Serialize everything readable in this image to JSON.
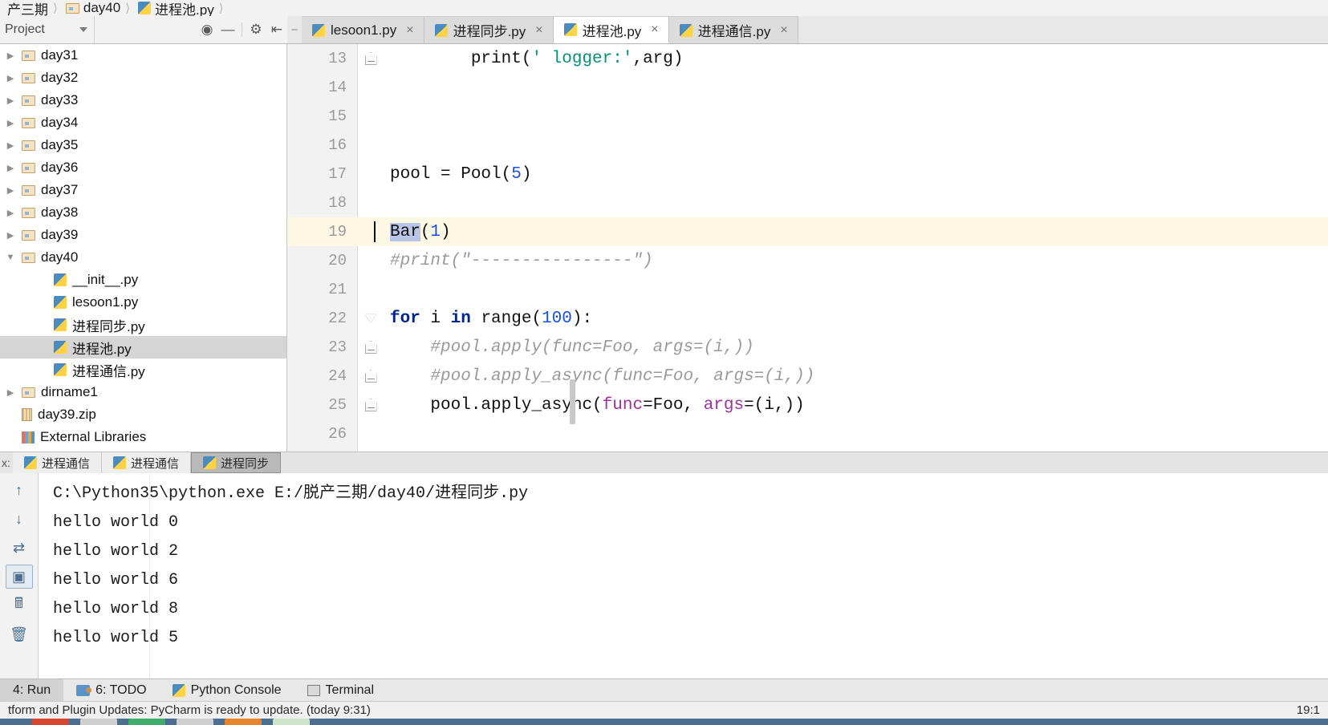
{
  "breadcrumb": {
    "items": [
      {
        "label": "产三期",
        "icon": "none"
      },
      {
        "label": "day40",
        "icon": "folder-icon"
      },
      {
        "label": "进程池.py",
        "icon": "python-file-icon"
      }
    ]
  },
  "project_toolbar": {
    "title": "Project",
    "icons": [
      "target-icon",
      "collapse-all-icon",
      "settings-gear-icon",
      "hide-panel-icon"
    ]
  },
  "editor_tabs": [
    {
      "label": "lesoon1.py",
      "active": false,
      "close": "×"
    },
    {
      "label": "进程同步.py",
      "active": false,
      "close": "×"
    },
    {
      "label": "进程池.py",
      "active": true,
      "close": "×"
    },
    {
      "label": "进程通信.py",
      "active": false,
      "close": "×"
    }
  ],
  "project_tree": [
    {
      "label": "day31",
      "type": "folder",
      "indent": 0,
      "expanded": false,
      "selected": false
    },
    {
      "label": "day32",
      "type": "folder",
      "indent": 0,
      "expanded": false,
      "selected": false
    },
    {
      "label": "day33",
      "type": "folder",
      "indent": 0,
      "expanded": false,
      "selected": false
    },
    {
      "label": "day34",
      "type": "folder",
      "indent": 0,
      "expanded": false,
      "selected": false
    },
    {
      "label": "day35",
      "type": "folder",
      "indent": 0,
      "expanded": false,
      "selected": false
    },
    {
      "label": "day36",
      "type": "folder",
      "indent": 0,
      "expanded": false,
      "selected": false
    },
    {
      "label": "day37",
      "type": "folder",
      "indent": 0,
      "expanded": false,
      "selected": false
    },
    {
      "label": "day38",
      "type": "folder",
      "indent": 0,
      "expanded": false,
      "selected": false
    },
    {
      "label": "day39",
      "type": "folder",
      "indent": 0,
      "expanded": false,
      "selected": false
    },
    {
      "label": "day40",
      "type": "folder",
      "indent": 0,
      "expanded": true,
      "selected": false
    },
    {
      "label": "__init__.py",
      "type": "python",
      "indent": 1,
      "expanded": false,
      "selected": false
    },
    {
      "label": "lesoon1.py",
      "type": "python",
      "indent": 1,
      "expanded": false,
      "selected": false
    },
    {
      "label": "进程同步.py",
      "type": "python",
      "indent": 1,
      "expanded": false,
      "selected": false
    },
    {
      "label": "进程池.py",
      "type": "python",
      "indent": 1,
      "expanded": false,
      "selected": true
    },
    {
      "label": "进程通信.py",
      "type": "python",
      "indent": 1,
      "expanded": false,
      "selected": false
    },
    {
      "label": "dirname1",
      "type": "folder",
      "indent": 0,
      "expanded": false,
      "selected": false
    },
    {
      "label": "day39.zip",
      "type": "zip",
      "indent": 0,
      "expanded": false,
      "selected": false
    },
    {
      "label": "External Libraries",
      "type": "library",
      "indent": -1,
      "expanded": false,
      "selected": false
    }
  ],
  "editor": {
    "lines": [
      {
        "num": "13",
        "highlight": false,
        "fold": "house",
        "tokens": [
          {
            "t": "        print",
            "c": "plain"
          },
          {
            "t": "(",
            "c": "plain"
          },
          {
            "t": "' logger:'",
            "c": "str"
          },
          {
            "t": ",arg)",
            "c": "plain"
          }
        ]
      },
      {
        "num": "14",
        "highlight": false,
        "fold": "none",
        "tokens": []
      },
      {
        "num": "15",
        "highlight": false,
        "fold": "none",
        "tokens": []
      },
      {
        "num": "16",
        "highlight": false,
        "fold": "none",
        "tokens": []
      },
      {
        "num": "17",
        "highlight": false,
        "fold": "none",
        "tokens": [
          {
            "t": "pool = Pool",
            "c": "plain"
          },
          {
            "t": "(",
            "c": "plain"
          },
          {
            "t": "5",
            "c": "num"
          },
          {
            "t": ")",
            "c": "plain"
          }
        ]
      },
      {
        "num": "18",
        "highlight": false,
        "fold": "none",
        "tokens": []
      },
      {
        "num": "19",
        "highlight": true,
        "fold": "none",
        "tokens": [
          {
            "t": "Bar",
            "c": "sel"
          },
          {
            "t": "(",
            "c": "plain"
          },
          {
            "t": "1",
            "c": "num"
          },
          {
            "t": ")",
            "c": "plain"
          }
        ]
      },
      {
        "num": "20",
        "highlight": false,
        "fold": "none",
        "tokens": [
          {
            "t": "#print(\"----------------\")",
            "c": "cmt"
          }
        ]
      },
      {
        "num": "21",
        "highlight": false,
        "fold": "none",
        "tokens": []
      },
      {
        "num": "22",
        "highlight": false,
        "fold": "tri",
        "tokens": [
          {
            "t": "for",
            "c": "kw"
          },
          {
            "t": " i ",
            "c": "plain"
          },
          {
            "t": "in",
            "c": "kw"
          },
          {
            "t": " range",
            "c": "plain"
          },
          {
            "t": "(",
            "c": "plain"
          },
          {
            "t": "100",
            "c": "num"
          },
          {
            "t": "):",
            "c": "plain"
          }
        ]
      },
      {
        "num": "23",
        "highlight": false,
        "fold": "mid",
        "tokens": [
          {
            "t": "    #pool.apply(func=Foo, args=(i,))",
            "c": "cmt"
          }
        ]
      },
      {
        "num": "24",
        "highlight": false,
        "fold": "mid",
        "tokens": [
          {
            "t": "    #pool.apply_async(func=Foo, args=(i,))",
            "c": "cmt"
          }
        ]
      },
      {
        "num": "25",
        "highlight": false,
        "fold": "mid",
        "tokens": [
          {
            "t": "    pool.apply_async",
            "c": "plain"
          },
          {
            "t": "(",
            "c": "plain"
          },
          {
            "t": "func",
            "c": "fnarg"
          },
          {
            "t": "=Foo, ",
            "c": "plain"
          },
          {
            "t": "args",
            "c": "fnarg"
          },
          {
            "t": "=(i,))",
            "c": "plain"
          }
        ]
      },
      {
        "num": "26",
        "highlight": false,
        "fold": "none",
        "tokens": []
      }
    ]
  },
  "run_tabs": [
    {
      "label": "进程通信",
      "active": false
    },
    {
      "label": "进程通信",
      "active": false
    },
    {
      "label": "进程同步",
      "active": true
    }
  ],
  "run_side_icons": [
    "scroll-up-icon",
    "scroll-down-icon",
    "soft-wrap-icon",
    "print-icon",
    "export-icon",
    "trash-icon"
  ],
  "console": {
    "lines": [
      "C:\\Python35\\python.exe E:/脱产三期/day40/进程同步.py",
      "hello world 0",
      "hello world 2",
      "hello world 6",
      "hello world 8",
      "hello world 5"
    ]
  },
  "bottom_toolbar": [
    {
      "label": "4: Run",
      "icon": "run-icon",
      "active": true
    },
    {
      "label": "6: TODO",
      "icon": "todo-icon",
      "active": false
    },
    {
      "label": "Python Console",
      "icon": "python-console-icon",
      "active": false
    },
    {
      "label": "Terminal",
      "icon": "terminal-icon",
      "active": false
    }
  ],
  "statusbar": {
    "message": "tform and Plugin Updates: PyCharm is ready to update. (today 9:31)",
    "right": "19:1"
  },
  "colors": {
    "accent_blue": "#4a6f91",
    "selection": "#b9c6e8",
    "highlight_line": "#fcf8e4",
    "tree_selection": "#d5d5d5"
  }
}
